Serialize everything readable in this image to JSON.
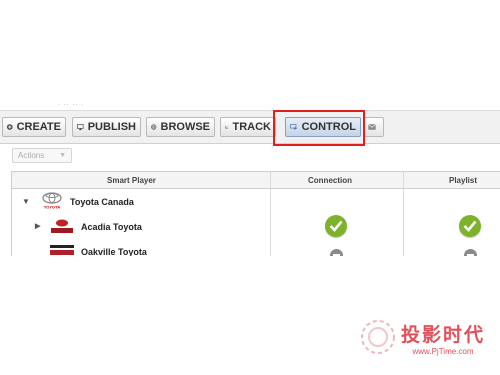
{
  "toolbar": {
    "create": "CREATE",
    "publish": "PUBLISH",
    "browse": "BROWSE",
    "track": "TRACK",
    "control": "CONTROL"
  },
  "actions": {
    "label": "Actions"
  },
  "grid": {
    "headers": [
      "Smart Player",
      "Connection",
      "Playlist"
    ],
    "rows": [
      {
        "name": "Toyota Canada",
        "connection": null,
        "playlist": null
      },
      {
        "name": "Acadia Toyota",
        "connection": "online",
        "playlist": "online"
      },
      {
        "name": "Oakville Toyota",
        "connection": "offline",
        "playlist": "offline"
      }
    ],
    "logo_text": "TOYOTA"
  },
  "watermark": {
    "title": "投影时代",
    "url": "www.PjTime.com"
  },
  "colors": {
    "highlight": "#e0201c",
    "ok": "#7cb32a",
    "offline": "#8a8a8a"
  }
}
